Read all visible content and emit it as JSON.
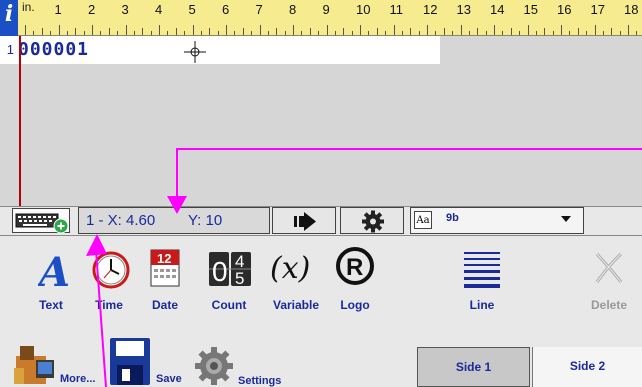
{
  "ruler": {
    "info_symbol": "i",
    "unit": "in.",
    "labels": [
      "1",
      "2",
      "3",
      "4",
      "5",
      "6",
      "7",
      "8",
      "9",
      "10",
      "11",
      "12",
      "13",
      "14",
      "15",
      "16",
      "17",
      "18"
    ]
  },
  "canvas": {
    "row_number": "1",
    "row_text": "000001"
  },
  "toolbar": {
    "coord_x": "1 - X: 4.60",
    "coord_y": "Y: 10",
    "font_label": "Aa",
    "font_size": "9b"
  },
  "tools": [
    {
      "label": "Text",
      "icon": "text-icon"
    },
    {
      "label": "Time",
      "icon": "clock-icon"
    },
    {
      "label": "Date",
      "icon": "calendar-icon"
    },
    {
      "label": "Count",
      "icon": "counter-icon"
    },
    {
      "label": "Variable",
      "icon": "variable-icon"
    },
    {
      "label": "Logo",
      "icon": "logo-icon"
    },
    {
      "label": "Line",
      "icon": "line-icon"
    },
    {
      "label": "Delete",
      "icon": "delete-icon"
    }
  ],
  "bottom": {
    "more_label": "More...",
    "save_label": "Save",
    "settings_label": "Settings",
    "side1_label": "Side 1",
    "side2_label": "Side 2"
  },
  "colors": {
    "ruler_bg": "#f6ec8f",
    "accent_blue": "#1a2a9a",
    "pointer": "#ff00ff"
  }
}
